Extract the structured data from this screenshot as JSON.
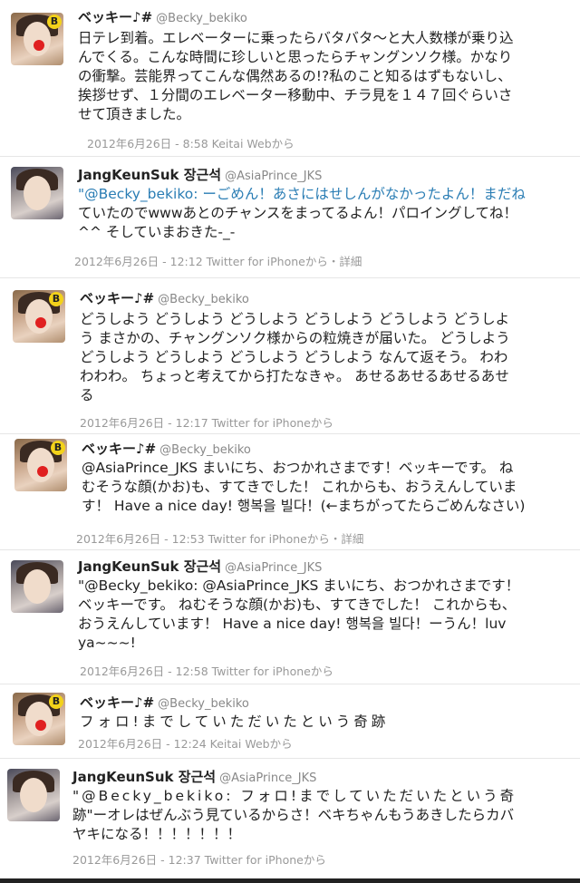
{
  "tweets": [
    {
      "name": "ベッキー♪#",
      "handle": "@Becky_bekiko",
      "lines": [
        "日テレ到着。エレベーターに乗ったらバタバタ～と大人数様が乗り込",
        "んでくる。こんな時間に珍しいと思ったらチャングンソク様。かなり",
        "の衝撃。芸能界ってこんな偶然あるの!?私のこと知るはずもないし、",
        "挨拶せず、１分間のエレベーター移動中、チラ見を１４７回ぐらいさ",
        "せて頂きました。"
      ],
      "meta": "2012年6月26日 - 8:58 Keitai Webから"
    },
    {
      "name": "JangKeunSuk 장근석",
      "handle": "@AsiaPrince_JKS",
      "mention": "@Becky_bekiko",
      "lines": [
        "\"@Becky_bekiko: ーごめん！あさにはせしんがなかったよん！まだね",
        "ていたのでwwwあとのチャンスをまってるよん！パロイングしてね！",
        "^^ そしていまおきた-_-"
      ],
      "meta": "2012年6月26日 - 12:12 Twitter for iPhoneから・詳細"
    },
    {
      "name": "ベッキー♪#",
      "handle": "@Becky_bekiko",
      "lines": [
        "どうしよう どうしよう どうしよう どうしよう どうしよう どうしよ",
        "う まさかの、チャングンソク様からの粒焼きが届いた。 どうしよう",
        "どうしよう どうしよう どうしよう どうしよう なんて返そう。 わわ",
        "わわわ。 ちょっと考えてから打たなきゃ。 あせるあせるあせるあせ",
        "る"
      ],
      "meta": "2012年6月26日 - 12:17 Twitter for iPhoneから"
    },
    {
      "name": "ベッキー♪#",
      "handle": "@Becky_bekiko",
      "mention": "@AsiaPrince_JKS",
      "lines": [
        "@AsiaPrince_JKS まいにち、おつかれさまです！ベッキーです。 ね",
        "むそうな顔(かお)も、すてきでした！ これからも、おうえんしていま",
        "す！ Have a nice day! 행복을 빌다！(←まちがってたらごめんなさい)"
      ],
      "meta": "2012年6月26日 - 12:53 Twitter for iPhoneから・詳細"
    },
    {
      "name": "JangKeunSuk 장근석",
      "handle": "@AsiaPrince_JKS",
      "mention": "@Becky_bekiko: @AsiaPrince_JKS",
      "lines": [
        "\"@Becky_bekiko: @AsiaPrince_JKS まいにち、おつかれさまです！",
        "ベッキーです。 ねむそうな顔(かお)も、すてきでした！ これからも、",
        "おうえんしています！ Have a nice day! 행복을 빌다！ーうん！luv",
        "ya~~~!"
      ],
      "meta": "2012年6月26日 - 12:58 Twitter for iPhoneから"
    },
    {
      "name": "ベッキー♪#",
      "handle": "@Becky_bekiko",
      "lines": [
        "フォロ!までしていただいたという奇跡"
      ],
      "meta": "2012年6月26日 - 12:24 Keitai Webから"
    },
    {
      "name": "JangKeunSuk 장근석",
      "handle": "@AsiaPrince_JKS",
      "mention": "@Becky_bekiko",
      "lines": [
        "\"@Becky_bekiko: フォロ!までしていただいたという奇",
        "跡\"ーオレはぜんぶう見ているからさ！ベキちゃんもうあきしたらカバ",
        "ヤキになる！！！！！！！"
      ],
      "meta": "2012年6月26日 - 12:37 Twitter for iPhoneから"
    }
  ]
}
